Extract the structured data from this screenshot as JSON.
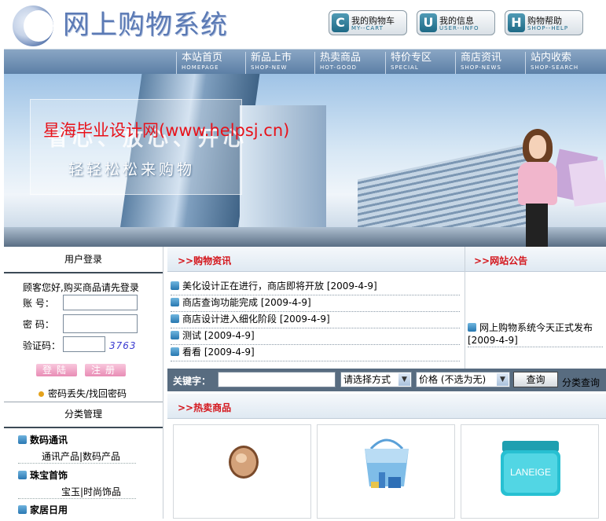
{
  "header": {
    "site_title": "网上购物系统",
    "buttons": [
      {
        "letter": "C",
        "label": "我的购物车",
        "sub": "MY--CART"
      },
      {
        "letter": "U",
        "label": "我的信息",
        "sub": "USER--INFO"
      },
      {
        "letter": "H",
        "label": "购物帮助",
        "sub": "SHOP--HELP"
      }
    ]
  },
  "nav": [
    {
      "label": "本站首页",
      "sub": "HOMEPAGE"
    },
    {
      "label": "新品上市",
      "sub": "SHOP-NEW"
    },
    {
      "label": "热卖商品",
      "sub": "HOT-GOOD"
    },
    {
      "label": "特价专区",
      "sub": "SPECIAL"
    },
    {
      "label": "商店资讯",
      "sub": "SHOP-NEWS"
    },
    {
      "label": "站内收索",
      "sub": "SHOP-SEARCH"
    }
  ],
  "banner": {
    "faint_text": "省心、放心、开心",
    "slogan": "轻轻松松来购物",
    "watermark": "星海毕业设计网(www.helpsj.cn)"
  },
  "login": {
    "title": "用户登录",
    "tip": "顾客您好,购买商品请先登录",
    "account_label": "账  号：",
    "password_label": "密  码：",
    "captcha_label": "验证码：",
    "captcha_value": "3763",
    "login_button": "登陆",
    "register_button": "注册",
    "forgot_link": "密码丢失/找回密码"
  },
  "categories": {
    "title": "分类管理",
    "groups": [
      {
        "name": "数码通讯",
        "subs": "通讯产品|数码产品"
      },
      {
        "name": "珠宝首饰",
        "subs": "宝玉|时尚饰品"
      },
      {
        "name": "家居日用",
        "subs": ""
      }
    ]
  },
  "news": {
    "title": ">>购物资讯",
    "items": [
      "美化设计正在进行，商店即将开放 [2009-4-9]",
      "商店查询功能完成 [2009-4-9]",
      "商店设计进入细化阶段 [2009-4-9]",
      "测试 [2009-4-9]",
      "看看 [2009-4-9]"
    ]
  },
  "notice": {
    "title": ">>网站公告",
    "item": "网上购物系统今天正式发布 [2009-4-9]"
  },
  "search": {
    "label": "关键字：",
    "keyword_value": "",
    "method_select": "请选择方式",
    "price_select": "价格 (不选为无)",
    "query_button": "查询",
    "category_query_link": "分类查询"
  },
  "hot": {
    "title": ">>热卖商品",
    "products": [
      {
        "icon": "compact-powder-icon",
        "name": ""
      },
      {
        "icon": "handbag-icon",
        "name": ""
      },
      {
        "icon": "laneige-cream-icon",
        "name": "",
        "brand": "LANEIGE"
      }
    ]
  },
  "colors": {
    "accent_red": "#d4161c",
    "nav_blue": "#6f8fb3",
    "search_bar": "#586c80"
  }
}
